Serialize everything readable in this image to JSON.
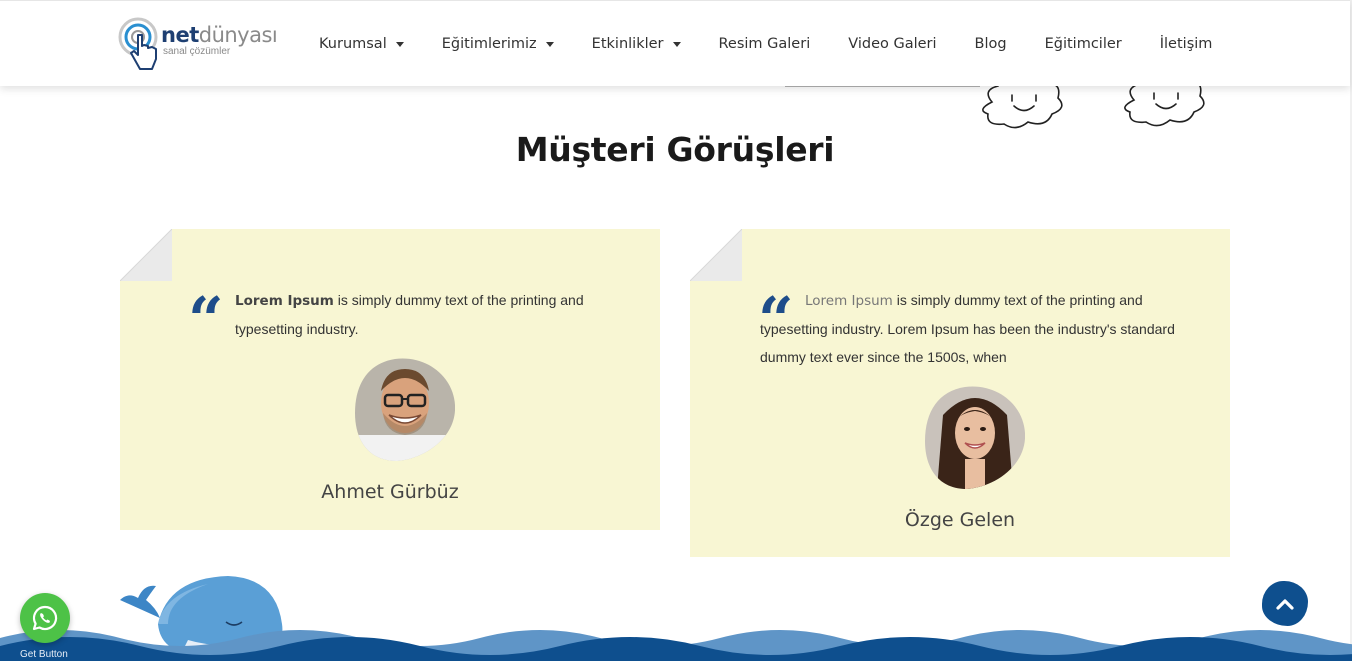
{
  "brand": {
    "name_bold": "net",
    "name_light": "dünyası",
    "tagline": "sanal çözümler"
  },
  "nav": {
    "items": [
      {
        "label": "Kurumsal",
        "dropdown": true
      },
      {
        "label": "Eğitimlerimiz",
        "dropdown": true
      },
      {
        "label": "Etkinlikler",
        "dropdown": true
      },
      {
        "label": "Resim Galeri",
        "dropdown": false
      },
      {
        "label": "Video Galeri",
        "dropdown": false
      },
      {
        "label": "Blog",
        "dropdown": false
      },
      {
        "label": "Eğitimciler",
        "dropdown": false
      },
      {
        "label": "İletişim",
        "dropdown": false
      }
    ]
  },
  "section": {
    "title": "Müşteri Görüşleri"
  },
  "testimonials": [
    {
      "lead": "Lorem Ipsum",
      "text": " is simply dummy text of the printing and typesetting industry.",
      "name": "Ahmet Gürbüz"
    },
    {
      "lead": "Lorem Ipsum",
      "text": " is simply dummy text of the printing and typesetting industry. Lorem Ipsum has been the industry's standard dummy text ever since the 1500s, when",
      "name": "Özge Gelen"
    }
  ],
  "widgets": {
    "whatsapp_label": "Get Button"
  },
  "colors": {
    "card_bg": "#f8f6d3",
    "quote_blue": "#1e4d8a",
    "wave_blue": "#0e4f8e",
    "whatsapp_green": "#4dc247"
  }
}
